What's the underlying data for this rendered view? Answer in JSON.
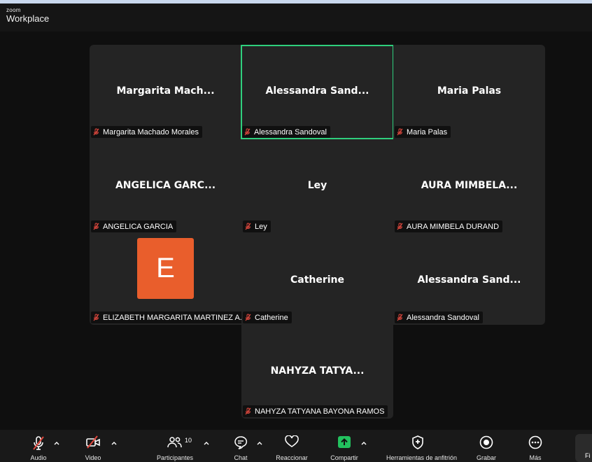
{
  "app": {
    "logo_small": "zoom",
    "logo_big": "Workplace"
  },
  "tiles": [
    {
      "big": "Margarita Mach...",
      "label": "Margarita Machado Morales"
    },
    {
      "big": "Alessandra Sand...",
      "label": "Alessandra Sandoval"
    },
    {
      "big": "Maria Palas",
      "label": "Maria Palas"
    },
    {
      "big": "ANGELICA GARC...",
      "label": "ANGELICA GARCIA"
    },
    {
      "big": "Ley",
      "label": "Ley"
    },
    {
      "big": "AURA MIMBELA...",
      "label": "AURA MIMBELA DURAND"
    },
    {
      "avatar": "E",
      "label": "ELIZABETH MARGARITA MARTINEZ A..."
    },
    {
      "big": "Catherine",
      "label": "Catherine"
    },
    {
      "big": "Alessandra Sand...",
      "label": "Alessandra Sandoval"
    },
    {
      "big": "NAHYZA TATYA...",
      "label": "NAHYZA TATYANA BAYONA RAMOS"
    }
  ],
  "toolbar": {
    "audio": "Audio",
    "video": "Video",
    "participants": "Participantes",
    "participants_count": "10",
    "chat": "Chat",
    "react": "Reaccionar",
    "share": "Compartir",
    "host_tools": "Herramientas de anfitrión",
    "record": "Grabar",
    "more": "Más",
    "end": "Fi"
  },
  "colors": {
    "active_speaker": "#2fcf7d",
    "muted": "#e0483e",
    "share": "#22c15e",
    "avatar": "#e95e2c"
  }
}
